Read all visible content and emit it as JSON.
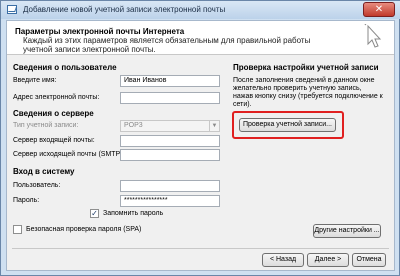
{
  "window": {
    "title": "Добавление новой учетной записи электронной почты",
    "close_label": "✕"
  },
  "header": {
    "title": "Параметры электронной почты Интернета",
    "description": "Каждый из этих параметров является обязательным для правильной работы учетной записи электронной почты."
  },
  "user_info": {
    "title": "Сведения о пользователе",
    "name_label": "Введите имя:",
    "name_value": "Иван Иванов",
    "email_label": "Адрес электронной почты:",
    "email_value": ""
  },
  "server_info": {
    "title": "Сведения о сервере",
    "account_type_label": "Тип учетной записи:",
    "account_type_value": "POP3",
    "incoming_label": "Сервер входящей почты:",
    "incoming_value": "",
    "outgoing_label": "Сервер исходящей почты (SMTP):",
    "outgoing_value": ""
  },
  "logon_info": {
    "title": "Вход в систему",
    "user_label": "Пользователь:",
    "user_value": "",
    "password_label": "Пароль:",
    "password_value": "****************",
    "remember_label": "Запомнить пароль",
    "remember_checked": "✓",
    "spa_label": "Безопасная проверка пароля (SPA)"
  },
  "test_settings": {
    "title": "Проверка настройки учетной записи",
    "description": "После заполнения сведений в данном окне желательно проверить учетную запись, нажав кнопку снизу (требуется подключение к сети).",
    "test_button": "Проверка учетной записи..."
  },
  "buttons": {
    "more_settings": "Другие настройки ...",
    "back": "< Назад",
    "next": "Далее >",
    "cancel": "Отмена"
  },
  "colors": {
    "highlight": "#e02020"
  }
}
